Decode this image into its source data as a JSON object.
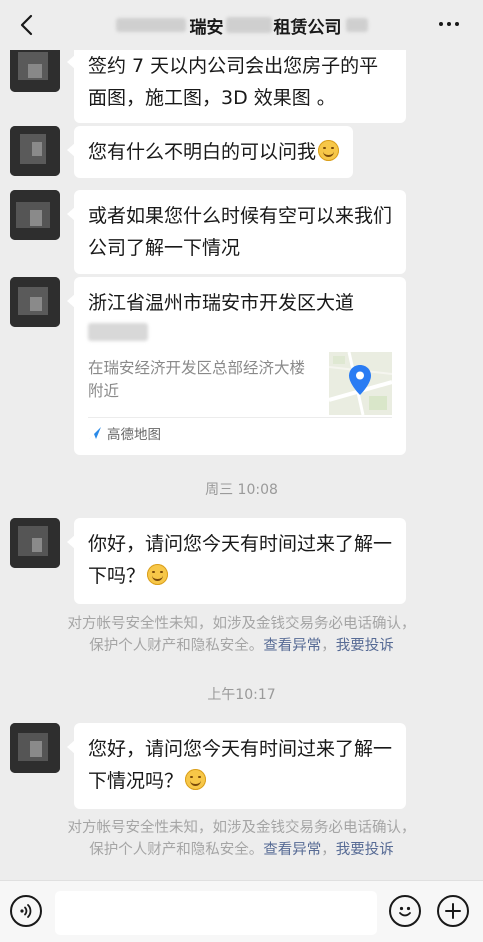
{
  "header": {
    "title_prefix": "瑞安",
    "title_suffix": "租赁公司"
  },
  "messages": [
    {
      "type": "text",
      "text": "签约 7 天以内公司会出您房子的平面图，施工图，3D 效果图 。"
    },
    {
      "type": "text",
      "text": "您有什么不明白的可以问我",
      "emoji": "smile"
    },
    {
      "type": "text",
      "text": "或者如果您什么时候有空可以来我们公司了解一下情况"
    },
    {
      "type": "location",
      "title": "浙江省温州市瑞安市开发区大道",
      "subtitle": "在瑞安经济开发区总部经济大楼附近",
      "source": "高德地图"
    }
  ],
  "time1": "周三 10:08",
  "msg5": {
    "text": "你好，请问您今天有时间过来了解一下吗？",
    "emoji": "smile"
  },
  "notice": {
    "line1": "对方帐号安全性未知，如涉及金钱交易务必电话确认，",
    "line2_prefix": "保护个人财产和隐私安全。",
    "link1": "查看异常",
    "sep": "，",
    "link2": "我要投诉"
  },
  "time2": "上午10:17",
  "msg6": {
    "text": "您好，请问您今天有时间过来了解一下情况吗？",
    "emoji": "smile"
  },
  "icons": {
    "back": "chevron-left-icon",
    "more": "more-icon",
    "voice": "voice-icon",
    "emoji": "emoji-icon",
    "plus": "plus-icon",
    "map_source": "amap-logo-icon",
    "map_pin": "map-pin-icon"
  },
  "colors": {
    "background": "#ededed",
    "link": "#576b95",
    "pin": "#2a7cf3"
  }
}
